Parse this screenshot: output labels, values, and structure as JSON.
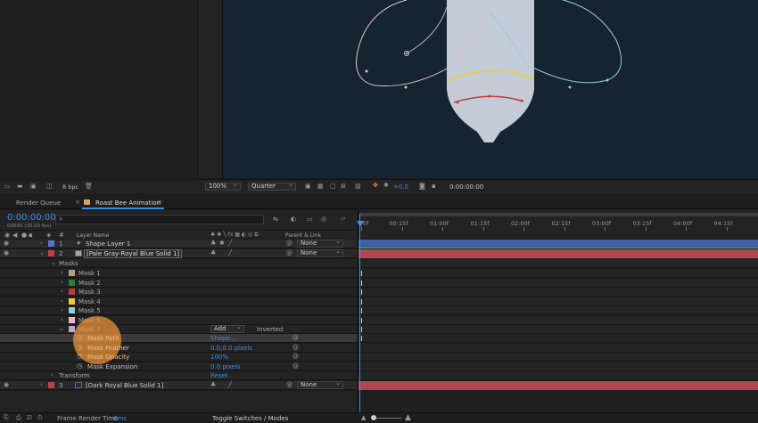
{
  "viewer": {
    "zoom": "100%",
    "resolution": "Quarter",
    "exposure": "+0.0",
    "timecode": "0:00:00:00",
    "bit_depth": "8 bpc"
  },
  "tabs": {
    "render_queue": "Render Queue",
    "comp": "Roast Bee Animation"
  },
  "timeline": {
    "current_time": "0:00:00:00",
    "frame_info": "00000 (30.00 fps)",
    "search_placeholder": "",
    "col_layer_name": "Layer Name",
    "col_parent": "Parent & Link",
    "ruler": [
      "0f",
      "00:15f",
      "01:00f",
      "01:15f",
      "02:00f",
      "02:15f",
      "03:00f",
      "03:15f",
      "04:00f",
      "04:15f"
    ],
    "layers": [
      {
        "num": "1",
        "name": "Shape Layer 1",
        "parent": "None",
        "color": "#5b6fd6"
      },
      {
        "num": "2",
        "name": "[Pale Gray-Royal Blue Solid 1]",
        "parent": "None",
        "color": "#c04040"
      },
      {
        "num": "3",
        "name": "[Dark Royal Blue Solid 1]",
        "parent": "None",
        "color": "#c04040"
      }
    ],
    "masks_group": "Masks",
    "masks": [
      {
        "name": "Mask 1",
        "color": "#b89c84"
      },
      {
        "name": "Mask 2",
        "color": "#2e7d3a"
      },
      {
        "name": "Mask 3",
        "color": "#c23b3b"
      },
      {
        "name": "Mask 4",
        "color": "#e6cf3a"
      },
      {
        "name": "Mask 5",
        "color": "#8fd0d8"
      },
      {
        "name": "Mask 6",
        "color": "#e8b8c8"
      },
      {
        "name": "Mask 7",
        "color": "#b8a8d8"
      }
    ],
    "mask_mode": "Add",
    "inverted_label": "Inverted",
    "mask_props": [
      {
        "name": "Mask Path",
        "value": "Shape..."
      },
      {
        "name": "Mask Feather",
        "value": "0.0,0.0 pixels"
      },
      {
        "name": "Mask Opacity",
        "value": "100%"
      },
      {
        "name": "Mask Expansion",
        "value": "0.0 pixels"
      }
    ],
    "transform_label": "Transform",
    "transform_reset": "Reset",
    "footer_render_label": "Frame Render Time",
    "footer_render_value": "0ms",
    "footer_toggle": "Toggle Switches / Modes"
  },
  "colors": {
    "canvas": "#162330",
    "bee_body": "#c3cbd6",
    "accent_blue": "#3b8ee0",
    "highlight_orange": "#e8923a",
    "track_red": "#b0474f",
    "track_blue": "#3f5fa8"
  }
}
